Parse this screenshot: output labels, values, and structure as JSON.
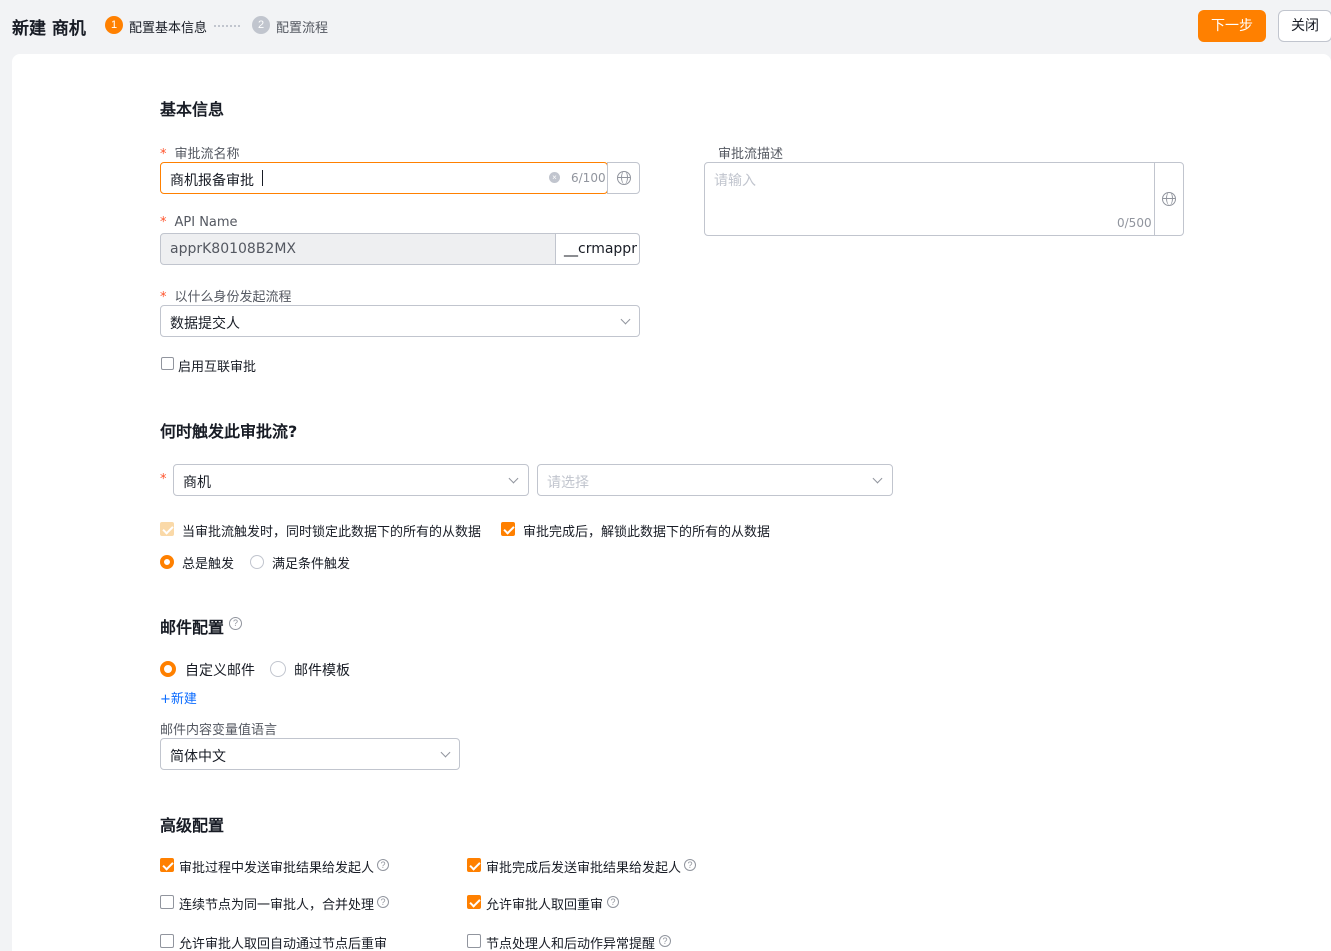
{
  "header": {
    "title": "新建 商机",
    "steps": [
      {
        "num": "1",
        "label": "配置基本信息"
      },
      {
        "num": "2",
        "label": "配置流程"
      }
    ],
    "next_label": "下一步",
    "close_label": "关闭"
  },
  "colors": {
    "accent": "#ff8000",
    "link": "#0c6cff",
    "required": "#ff522a"
  },
  "basic": {
    "section_title": "基本信息",
    "name": {
      "label": "审批流名称",
      "value": "商机报备审批",
      "counter": "6/100"
    },
    "api": {
      "label": "API Name",
      "value": "apprK80108B2MX",
      "suffix": "__crmappr"
    },
    "identity": {
      "label": "以什么身份发起流程",
      "value": "数据提交人"
    },
    "interconnect": {
      "label": "启用互联审批",
      "checked": false
    },
    "desc": {
      "label": "审批流描述",
      "placeholder": "请输入",
      "counter": "0/500"
    }
  },
  "trigger": {
    "section_title": "何时触发此审批流?",
    "object_value": "商机",
    "type_placeholder": "请选择",
    "lock_label": "当审批流触发时，同时锁定此数据下的所有的从数据",
    "unlock_label": "审批完成后，解锁此数据下的所有的从数据",
    "always_label": "总是触发",
    "condition_label": "满足条件触发"
  },
  "mail": {
    "section_title": "邮件配置",
    "custom_label": "自定义邮件",
    "template_label": "邮件模板",
    "new_link": "+新建",
    "lang_label": "邮件内容变量值语言",
    "lang_value": "简体中文"
  },
  "advanced": {
    "section_title": "高级配置",
    "items": [
      {
        "label": "审批过程中发送审批结果给发起人",
        "checked": true,
        "help": true
      },
      {
        "label": "审批完成后发送审批结果给发起人",
        "checked": true,
        "help": true
      },
      {
        "label": "连续节点为同一审批人，合并处理",
        "checked": false,
        "help": true
      },
      {
        "label": "允许审批人取回重审",
        "checked": true,
        "help": true
      },
      {
        "label": "允许审批人取回自动通过节点后重审",
        "checked": false,
        "help": false
      },
      {
        "label": "节点处理人和后动作异常提醒",
        "checked": false,
        "help": true
      }
    ]
  },
  "icons": {
    "help": "?",
    "clear": "×"
  }
}
